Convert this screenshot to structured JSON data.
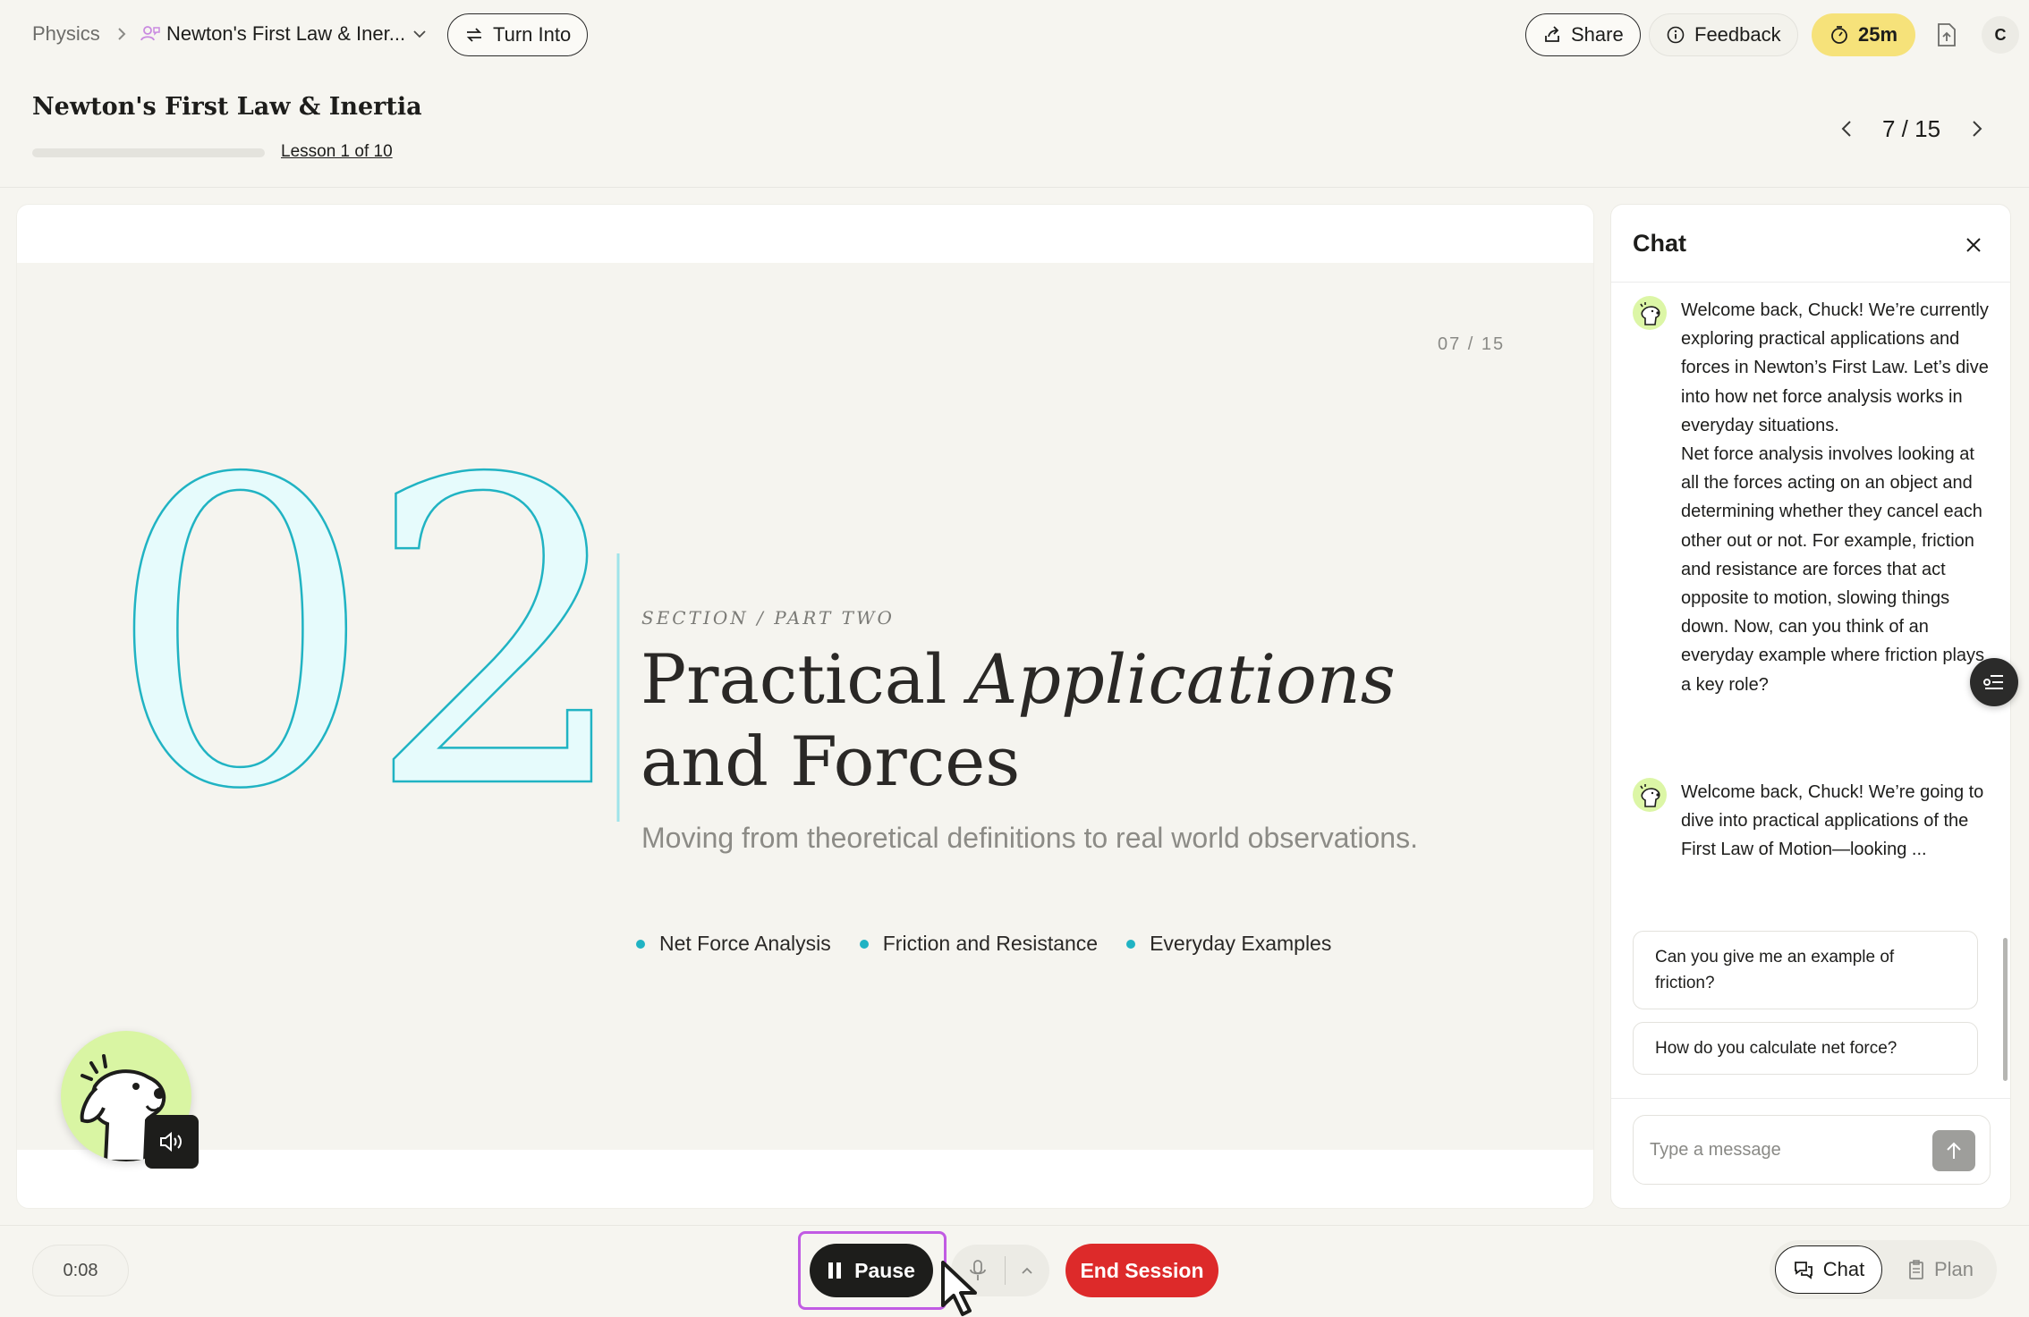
{
  "breadcrumb": {
    "root": "Physics",
    "current": "Newton's First Law & Iner..."
  },
  "toolbar": {
    "turn_into": "Turn Into",
    "share": "Share",
    "feedback": "Feedback",
    "timer": "25m",
    "avatar_initial": "C"
  },
  "header": {
    "title": "Newton's First Law & Inertia",
    "lesson_link": "Lesson 1 of 10",
    "lesson_progress": 0.0,
    "pager": "7 / 15"
  },
  "slide": {
    "counter": "07  /  15",
    "big_number": "02",
    "section_label": "SECTION / PART TWO",
    "title_plain": "Practical ",
    "title_italic": "Applications",
    "title_line2": "and Forces",
    "subtitle": "Moving from theoretical definitions to real world observations.",
    "bullets": [
      "Net Force Analysis",
      "Friction and Resistance",
      "Everyday Examples"
    ]
  },
  "chat": {
    "title": "Chat",
    "messages": [
      {
        "paragraphs": [
          "Welcome back, Chuck! We’re currently exploring practical applications and forces in Newton’s First Law. Let’s dive into how net force analysis works in everyday situations.",
          "Net force analysis involves looking at all the forces acting on an object and determining whether they cancel each other out or not. For example, friction and resistance are forces that act opposite to motion, slowing things down. Now, can you think of an everyday example where friction plays a key role?"
        ]
      },
      {
        "paragraphs": [
          "Welcome back, Chuck! We’re going to dive into practical applications of the First Law of Motion—looking ..."
        ]
      }
    ],
    "suggestions": [
      "Can you give me an example of friction?",
      "How do you calculate net force?"
    ],
    "input_placeholder": "Type a message"
  },
  "bottom": {
    "elapsed": "0:08",
    "pause": "Pause",
    "end_session": "End Session",
    "tab_chat": "Chat",
    "tab_plan": "Plan"
  },
  "colors": {
    "accent_teal": "#20b3c3",
    "timer_yellow": "#f6e27a",
    "end_red": "#dd2a2a",
    "highlight_purple": "#c15be3",
    "mascot_green": "#d9f5a3"
  },
  "icons": [
    "chevron-right-icon",
    "chat-people-icon",
    "chevron-down-icon",
    "swap-icon",
    "share-icon",
    "info-icon",
    "stopwatch-icon",
    "export-icon",
    "chevron-left-icon",
    "close-icon",
    "dog-mascot-icon",
    "speaker-icon",
    "send-arrow-icon",
    "list-settings-icon",
    "pause-icon",
    "mic-icon",
    "caret-up-icon",
    "chat-bubble-icon",
    "clipboard-icon",
    "cursor-icon"
  ]
}
